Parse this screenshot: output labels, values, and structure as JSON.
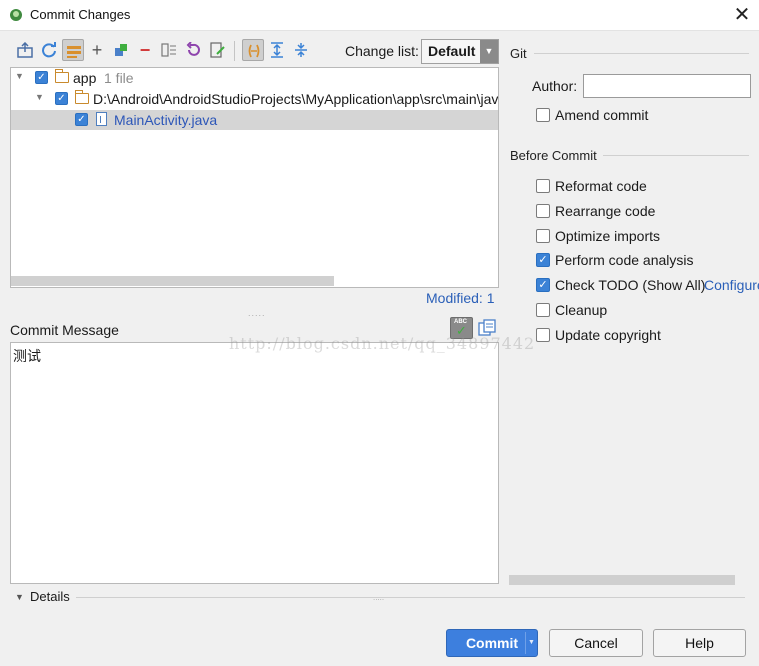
{
  "window": {
    "title": "Commit Changes",
    "close_glyph": "✕"
  },
  "toolbar": {
    "icons": [
      "diff-icon",
      "refresh-icon",
      "group-by-directory-icon",
      "expand-all-icon",
      "shelve-icon",
      "revert-icon",
      "move-icon",
      "rollback-icon",
      "edit-source-icon",
      "toggle-view-icon",
      "expand-icon",
      "collapse-icon"
    ],
    "changelist_label": "Change list:",
    "changelist_value": "Default"
  },
  "tree": {
    "rows": [
      {
        "label": "app",
        "meta": "1 file"
      },
      {
        "label": "D:\\Android\\AndroidStudioProjects\\MyApplication\\app\\src\\main\\java"
      },
      {
        "label": "MainActivity.java"
      }
    ],
    "modified": "Modified: 1"
  },
  "commit_message": {
    "label": "Commit Message",
    "value": "测试"
  },
  "watermark": "http://blog.csdn.net/qq_34897442",
  "git": {
    "section": "Git",
    "author_label": "Author:",
    "author_value": "",
    "amend": {
      "label": "Amend commit",
      "checked": false
    }
  },
  "before_commit": {
    "section": "Before Commit",
    "options": [
      {
        "label": "Reformat code",
        "checked": false
      },
      {
        "label": "Rearrange code",
        "checked": false
      },
      {
        "label": "Optimize imports",
        "checked": false
      },
      {
        "label": "Perform code analysis",
        "checked": true
      },
      {
        "label": "Check TODO (Show All)",
        "checked": true,
        "link": "Configure"
      },
      {
        "label": "Cleanup",
        "checked": false
      },
      {
        "label": "Update copyright",
        "checked": false
      }
    ]
  },
  "details": {
    "label": "Details"
  },
  "buttons": {
    "commit": "Commit",
    "cancel": "Cancel",
    "help": "Help"
  },
  "colors": {
    "accent": "#3d7fde",
    "link": "#2a5fb8",
    "checkbox": "#3b82d6"
  }
}
